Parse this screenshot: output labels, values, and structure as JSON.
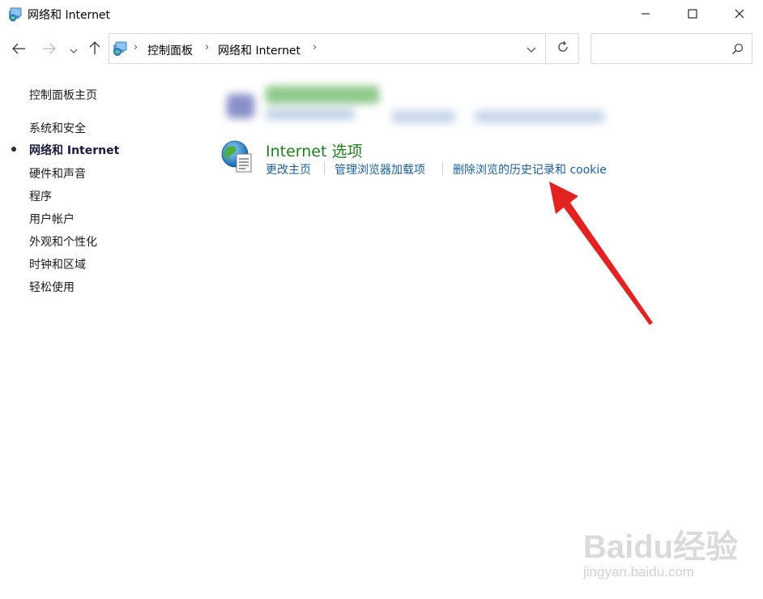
{
  "window": {
    "title": "网络和 Internet",
    "title_icon": "network-internet-icon"
  },
  "titlebar_controls": {
    "minimize_icon": "minimize-icon",
    "maximize_icon": "maximize-icon",
    "close_icon": "close-icon"
  },
  "navigation": {
    "back_icon": "arrow-left-icon",
    "forward_icon": "arrow-right-icon",
    "recent_icon": "chevron-down-icon",
    "up_icon": "arrow-up-icon"
  },
  "address": {
    "icon": "network-internet-icon",
    "breadcrumbs": [
      {
        "label": "控制面板"
      },
      {
        "label": "网络和 Internet"
      }
    ],
    "dropdown_icon": "chevron-down-icon",
    "refresh_icon": "refresh-icon"
  },
  "search": {
    "placeholder": "",
    "icon": "search-icon"
  },
  "sidebar": {
    "items": [
      {
        "label": "控制面板主页",
        "active": false
      },
      {
        "label": "系统和安全",
        "active": false
      },
      {
        "label": "网络和 Internet",
        "active": true
      },
      {
        "label": "硬件和声音",
        "active": false
      },
      {
        "label": "程序",
        "active": false
      },
      {
        "label": "用户帐户",
        "active": false
      },
      {
        "label": "外观和个性化",
        "active": false
      },
      {
        "label": "时钟和区域",
        "active": false
      },
      {
        "label": "轻松使用",
        "active": false
      }
    ]
  },
  "main": {
    "category": {
      "icon": "internet-options-globe-icon",
      "title": "Internet 选项",
      "links": [
        {
          "label": "更改主页"
        },
        {
          "label": "管理浏览器加载项"
        },
        {
          "label": "删除浏览的历史记录和 cookie"
        }
      ]
    }
  },
  "annotation": {
    "color": "#e32222",
    "icon": "red-arrow-annotation"
  },
  "watermark": {
    "brand": "Baidu经验",
    "url": "jingyan.baidu.com"
  },
  "colors": {
    "link": "#1a5e9e",
    "category_title": "#1e7d1e",
    "border": "#d9d9d9"
  }
}
